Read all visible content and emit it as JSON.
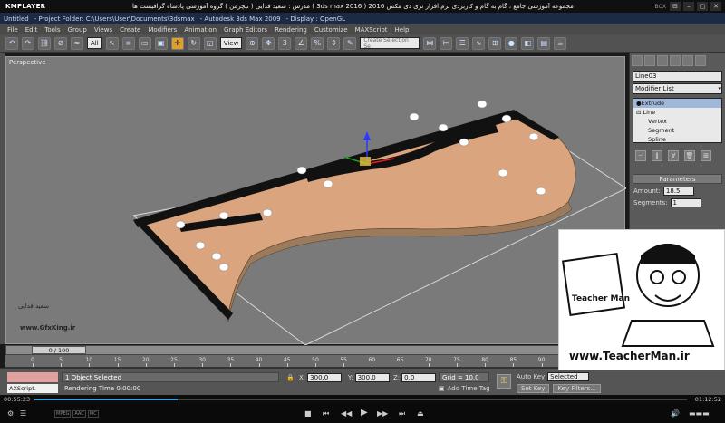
{
  "player": {
    "logo": "KMPLAYER",
    "title": "مجموعه آموزشی جامع ، گام به گام و کاربردی نرم افزار تری دی مکس 2016 ( 3ds max 2016 )    مدرس : سعید فدایی ( تیچرمن ) گروه آموزشی پادشاه گرافیست ها",
    "box_label": "BOX",
    "controls": [
      "⊟",
      "–",
      "▢",
      "✕"
    ]
  },
  "max_window": {
    "title_parts": [
      "Untitled",
      "- Project Folder: C:\\Users\\User\\Documents\\3dsmax",
      "- Autodesk 3ds Max 2009",
      "- Display : OpenGL"
    ]
  },
  "menu": [
    "File",
    "Edit",
    "Tools",
    "Group",
    "Views",
    "Create",
    "Modifiers",
    "Animation",
    "Graph Editors",
    "Rendering",
    "Customize",
    "MAXScript",
    "Help"
  ],
  "toolbar": {
    "filter_value": "All",
    "ref_coord_value": "View",
    "selection_set_placeholder": "Create Selection Se"
  },
  "viewport": {
    "label": "Perspective"
  },
  "command_panel": {
    "object_name": "Line03",
    "modifier_list": "Modifier List",
    "stack": [
      {
        "label": "Extrude",
        "selected": true,
        "level": 0
      },
      {
        "label": "Line",
        "selected": false,
        "level": 0,
        "prefix": "⊟"
      },
      {
        "label": "Vertex",
        "selected": false,
        "level": 1
      },
      {
        "label": "Segment",
        "selected": false,
        "level": 1
      },
      {
        "label": "Spline",
        "selected": false,
        "level": 1
      }
    ],
    "rollout_title": "Parameters",
    "amount_label": "Amount:",
    "amount_value": "18.5",
    "segments_label": "Segments:",
    "segments_value": "1"
  },
  "timeline": {
    "handle_label": "0 / 100",
    "ticks": [
      "0",
      "5",
      "10",
      "15",
      "20",
      "25",
      "30",
      "35",
      "40",
      "45",
      "50",
      "55",
      "60",
      "65",
      "70",
      "75",
      "80",
      "85",
      "90",
      "95",
      "100"
    ]
  },
  "status": {
    "maxscript_label": "AXScript.",
    "selection_text": "1 Object Selected",
    "rendering_text": "Rendering Time  0:00:00",
    "x_label": "X:",
    "x_value": "300.0",
    "y_label": "Y:",
    "y_value": "300.0",
    "z_label": "Z:",
    "z_value": "0.0",
    "grid_text": "Grid = 10.0",
    "add_time_tag": "Add Time Tag",
    "auto_key": "Auto Key",
    "selected_value": "Selected",
    "set_key": "Set Key",
    "key_filters": "Key Filters..."
  },
  "media": {
    "elapsed": "00:55:23",
    "total": "01:12:52",
    "progress": 0.22,
    "formats": [
      "MPEG",
      "AAC",
      "MC"
    ]
  },
  "watermark": {
    "site": "www.TeacherMan.ir",
    "author": "سعید فدایی",
    "gfx": "www.GfxKing.ir"
  }
}
